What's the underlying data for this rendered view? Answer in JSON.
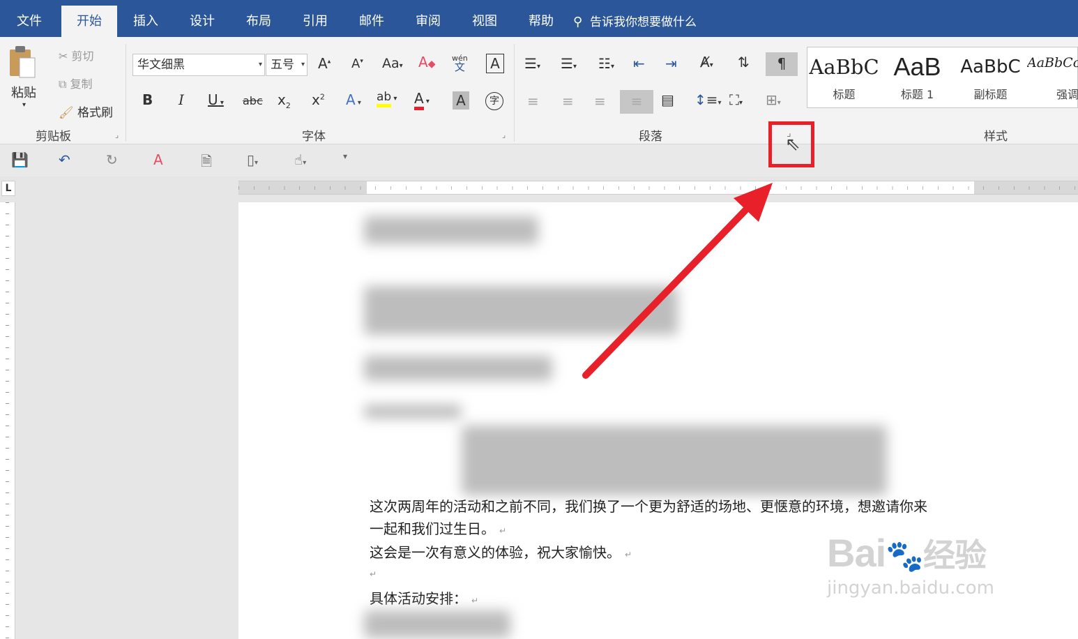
{
  "tabs": [
    "文件",
    "开始",
    "插入",
    "设计",
    "布局",
    "引用",
    "邮件",
    "审阅",
    "视图",
    "帮助"
  ],
  "active_tab": "开始",
  "tell_me": "告诉我你想要做什么",
  "clipboard": {
    "paste": "粘贴",
    "cut": "剪切",
    "copy": "复制",
    "format_painter": "格式刷",
    "group_label": "剪贴板"
  },
  "font": {
    "font_name": "华文细黑",
    "font_size": "五号",
    "change_case": "Aa",
    "phonetic_top": "wén",
    "phonetic_bottom": "文",
    "enclose_char": "字",
    "group_label": "字体"
  },
  "paragraph": {
    "group_label": "段落"
  },
  "styles": {
    "items": [
      {
        "sample": "AaBbC",
        "name": "标题"
      },
      {
        "sample": "AaB",
        "name": "标题 1"
      },
      {
        "sample": "AaBbC",
        "name": "副标题"
      },
      {
        "sample": "AaBbCc",
        "name": "强调"
      }
    ],
    "group_label": "样式"
  },
  "document": {
    "line1": "这次两周年的活动和之前不同，我们换了一个更为舒适的场地、更惬意的环境，想邀请你来",
    "line2": "一起和我们过生日。",
    "line3": "这会是一次有意义的体验，祝大家愉快。",
    "line5": "具体活动安排："
  },
  "watermark": {
    "logo": "Bai",
    "logo2": "经验",
    "url": "jingyan.baidu.com"
  },
  "colors": {
    "tabbar": "#2b579a",
    "highlight": "#e8202a",
    "font_color": "#e8202a",
    "highlight_color": "#ffff00"
  }
}
